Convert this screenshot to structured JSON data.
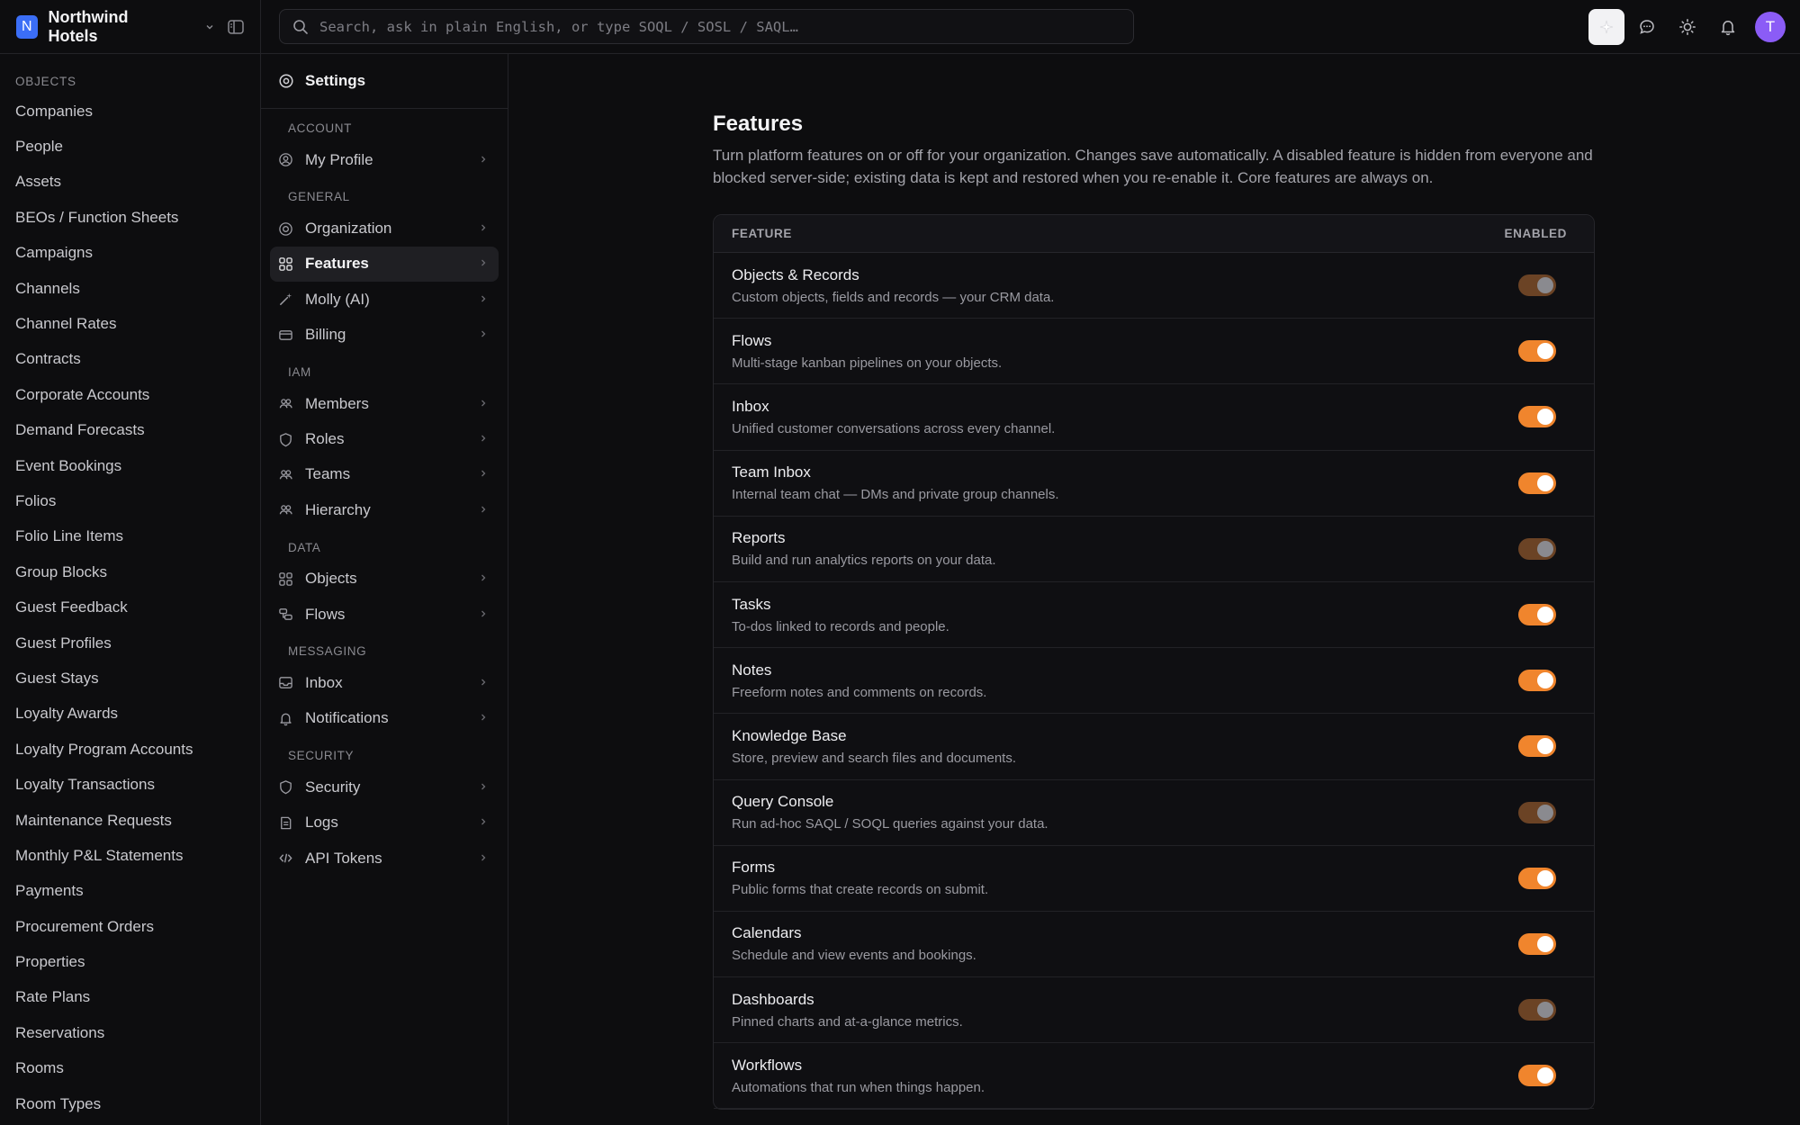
{
  "workspace": {
    "logo_letter": "N",
    "name": "Northwind Hotels"
  },
  "sidebar": {
    "section_label": "OBJECTS",
    "items": [
      "Companies",
      "People",
      "Assets",
      "BEOs / Function Sheets",
      "Campaigns",
      "Channels",
      "Channel Rates",
      "Contracts",
      "Corporate Accounts",
      "Demand Forecasts",
      "Event Bookings",
      "Folios",
      "Folio Line Items",
      "Group Blocks",
      "Guest Feedback",
      "Guest Profiles",
      "Guest Stays",
      "Loyalty Awards",
      "Loyalty Program Accounts",
      "Loyalty Transactions",
      "Maintenance Requests",
      "Monthly P&L Statements",
      "Payments",
      "Procurement Orders",
      "Properties",
      "Rate Plans",
      "Reservations",
      "Rooms",
      "Room Types"
    ]
  },
  "search": {
    "placeholder": "Search, ask in plain English, or type SOQL / SOSL / SAQL…"
  },
  "topbar": {
    "avatar_letter": "T",
    "icons": [
      "sparkle-icon",
      "chat-icon",
      "sun-icon",
      "bell-icon"
    ]
  },
  "settings_nav": {
    "title": "Settings",
    "groups": [
      {
        "label": "ACCOUNT",
        "items": [
          {
            "label": "My Profile",
            "icon": "user-circle-icon"
          }
        ]
      },
      {
        "label": "GENERAL",
        "items": [
          {
            "label": "Organization",
            "icon": "target-icon"
          },
          {
            "label": "Features",
            "icon": "grid-icon",
            "active": true
          },
          {
            "label": "Molly (AI)",
            "icon": "wand-icon"
          },
          {
            "label": "Billing",
            "icon": "card-icon"
          }
        ]
      },
      {
        "label": "IAM",
        "items": [
          {
            "label": "Members",
            "icon": "users-icon"
          },
          {
            "label": "Roles",
            "icon": "shield-icon"
          },
          {
            "label": "Teams",
            "icon": "users-icon"
          },
          {
            "label": "Hierarchy",
            "icon": "users-icon"
          }
        ]
      },
      {
        "label": "DATA",
        "items": [
          {
            "label": "Objects",
            "icon": "grid-icon"
          },
          {
            "label": "Flows",
            "icon": "flow-icon"
          }
        ]
      },
      {
        "label": "MESSAGING",
        "items": [
          {
            "label": "Inbox",
            "icon": "inbox-icon"
          },
          {
            "label": "Notifications",
            "icon": "bell-icon"
          }
        ]
      },
      {
        "label": "SECURITY",
        "items": [
          {
            "label": "Security",
            "icon": "shield-icon"
          },
          {
            "label": "Logs",
            "icon": "log-icon"
          },
          {
            "label": "API Tokens",
            "icon": "code-icon"
          }
        ]
      }
    ]
  },
  "main": {
    "title": "Features",
    "description": "Turn platform features on or off for your organization. Changes save automatically. A disabled feature is hidden from everyone and blocked server-side; existing data is kept and restored when you re-enable it. Core features are always on.",
    "table": {
      "col_feature": "FEATURE",
      "col_enabled": "ENABLED",
      "rows": [
        {
          "name": "Objects & Records",
          "desc": "Custom objects, fields and records — your CRM data.",
          "enabled": true,
          "core": true
        },
        {
          "name": "Flows",
          "desc": "Multi-stage kanban pipelines on your objects.",
          "enabled": true,
          "core": false
        },
        {
          "name": "Inbox",
          "desc": "Unified customer conversations across every channel.",
          "enabled": true,
          "core": false
        },
        {
          "name": "Team Inbox",
          "desc": "Internal team chat — DMs and private group channels.",
          "enabled": true,
          "core": false
        },
        {
          "name": "Reports",
          "desc": "Build and run analytics reports on your data.",
          "enabled": true,
          "core": true
        },
        {
          "name": "Tasks",
          "desc": "To-dos linked to records and people.",
          "enabled": true,
          "core": false
        },
        {
          "name": "Notes",
          "desc": "Freeform notes and comments on records.",
          "enabled": true,
          "core": false
        },
        {
          "name": "Knowledge Base",
          "desc": "Store, preview and search files and documents.",
          "enabled": true,
          "core": false
        },
        {
          "name": "Query Console",
          "desc": "Run ad-hoc SAQL / SOQL queries against your data.",
          "enabled": true,
          "core": true
        },
        {
          "name": "Forms",
          "desc": "Public forms that create records on submit.",
          "enabled": true,
          "core": false
        },
        {
          "name": "Calendars",
          "desc": "Schedule and view events and bookings.",
          "enabled": true,
          "core": false
        },
        {
          "name": "Dashboards",
          "desc": "Pinned charts and at-a-glance metrics.",
          "enabled": true,
          "core": true
        },
        {
          "name": "Workflows",
          "desc": "Automations that run when things happen.",
          "enabled": true,
          "core": false
        }
      ]
    }
  },
  "colors": {
    "accent": "#f0852d",
    "accent_locked": "#6b4325",
    "brand": "#3b6ef6",
    "avatar": "#8b5cf6",
    "background": "#0d0d0f"
  }
}
